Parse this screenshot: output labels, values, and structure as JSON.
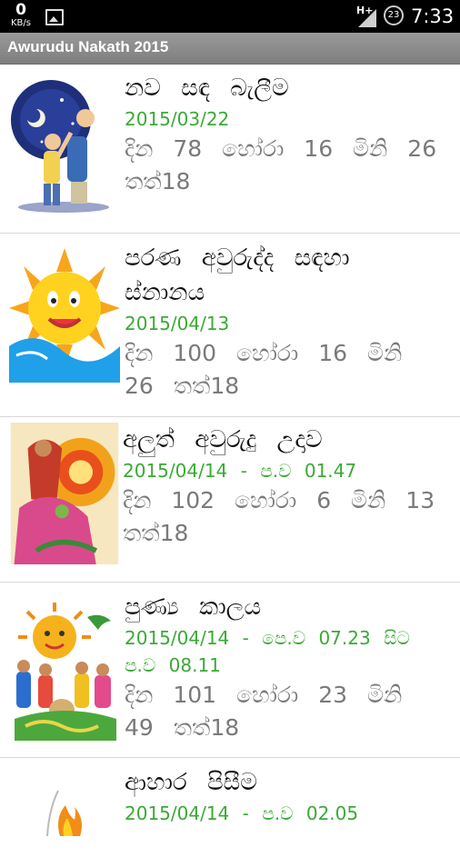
{
  "status_bar": {
    "speed": "0",
    "speed_unit": "KB/s",
    "network": "H+",
    "notification_count": "23",
    "time": "7:33"
  },
  "app": {
    "title": "Awurudu Nakath 2015"
  },
  "items": [
    {
      "name": "නව සඳ බැලීම",
      "date": "2015/03/22",
      "countdown": "දින 78 හෝරා 16 මිනි 26 තත්18"
    },
    {
      "name": "පරණ අවුරුද්ද සඳහා ස්නානය",
      "date": "2015/04/13",
      "countdown": "දින 100 හෝරා 16 මිනි 26 තත්18"
    },
    {
      "name": "අලුත් අවුරුදු උදාව",
      "date": "2015/04/14 - ප.ව 01.47",
      "countdown": "දින 102 හෝරා 6 මිනි 13 තත්18"
    },
    {
      "name": "පුණ්‍ය කාලය",
      "date": "2015/04/14 - පෙ.ව 07.23 සිට ප.ව 08.11",
      "countdown": "දින 101 හෝරා 23 මිනි 49 තත්18"
    },
    {
      "name": "ආහාර පිසීම",
      "date": "2015/04/14 - ප.ව 02.05",
      "countdown": ""
    }
  ],
  "icons": {
    "item_1": "moon-viewing-icon",
    "item_2": "sun-bathing-icon",
    "item_3": "new-year-dawn-icon",
    "item_4": "auspicious-time-icon",
    "item_5": "cooking-icon"
  }
}
